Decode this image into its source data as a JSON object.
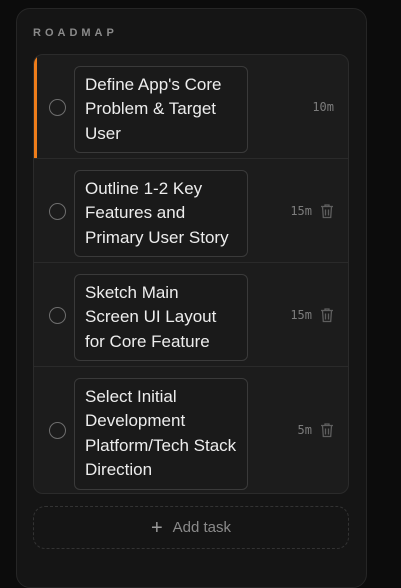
{
  "roadmap": {
    "title": "ROADMAP",
    "tasks": [
      {
        "title": "Define App's Core Problem & Target User",
        "duration": "10m",
        "active": true,
        "show_delete": false
      },
      {
        "title": "Outline 1-2 Key Features and Primary User Story",
        "duration": "15m",
        "active": false,
        "show_delete": true
      },
      {
        "title": "Sketch Main Screen UI Layout for Core Feature",
        "duration": "15m",
        "active": false,
        "show_delete": true
      },
      {
        "title": "Select Initial Development Platform/Tech Stack Direction",
        "duration": "5m",
        "active": false,
        "show_delete": true
      }
    ],
    "add_task_label": "Add task"
  },
  "colors": {
    "accent": "#ef7d1a",
    "background": "#0c0c0c",
    "panel": "#151515"
  },
  "icons": {
    "checkbox": "circle-outline-icon",
    "delete": "trash-icon",
    "add": "plus-icon"
  }
}
